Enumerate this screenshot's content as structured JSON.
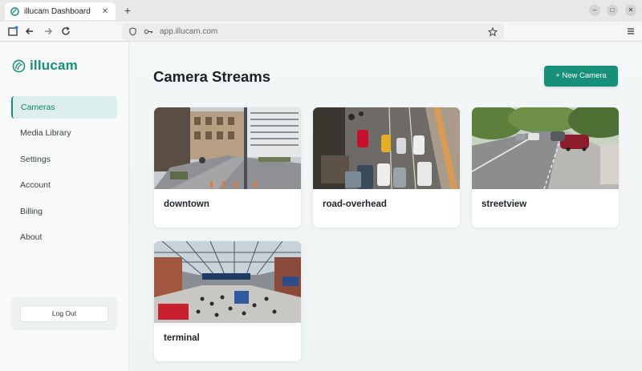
{
  "browser": {
    "tab_title": "illucam Dashboard",
    "tab_close": "✕",
    "new_tab": "+",
    "url": "app.illucam.com",
    "window_controls": {
      "minimize": "–",
      "maximize": "□",
      "close": "✕"
    }
  },
  "brand": {
    "name": "illucam",
    "color": "#17907a"
  },
  "sidebar": {
    "items": [
      {
        "label": "Cameras",
        "active": true
      },
      {
        "label": "Media Library",
        "active": false
      },
      {
        "label": "Settings",
        "active": false
      },
      {
        "label": "Account",
        "active": false
      },
      {
        "label": "Billing",
        "active": false
      },
      {
        "label": "About",
        "active": false
      }
    ],
    "logout_label": "Log Out"
  },
  "main": {
    "title": "Camera Streams",
    "new_camera_label": "+ New Camera",
    "cameras": [
      {
        "name": "downtown",
        "scene": "city-street-buildings"
      },
      {
        "name": "road-overhead",
        "scene": "overhead-traffic"
      },
      {
        "name": "streetview",
        "scene": "tree-lined-street"
      },
      {
        "name": "terminal",
        "scene": "train-station-concourse"
      }
    ]
  },
  "colors": {
    "accent": "#17907a",
    "active_bg": "#dcefec"
  }
}
